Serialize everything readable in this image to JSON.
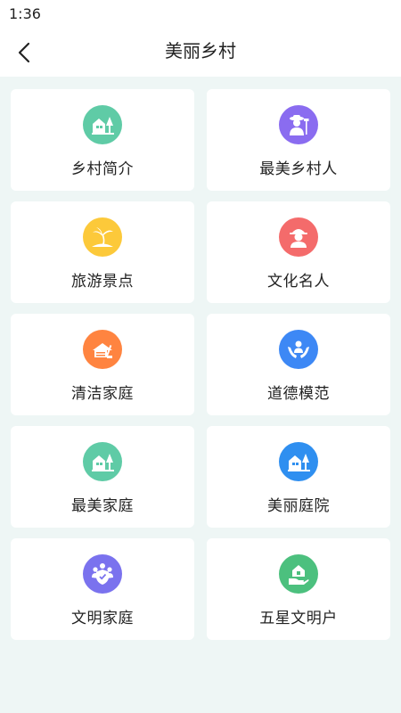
{
  "status": {
    "time": "1:36"
  },
  "header": {
    "title": "美丽乡村"
  },
  "colors": {
    "background": "#eef6f5",
    "green": "#5fcba6",
    "purple": "#8a6cf0",
    "yellow": "#fcc93a",
    "red": "#f46b6b",
    "orange": "#ff8440",
    "blue": "#3d88f5",
    "sky_blue": "#2f8ff0",
    "violet": "#7a72ee",
    "emerald": "#4cc07e"
  },
  "menu": [
    {
      "label": "乡村简介",
      "icon": "house-tree-icon",
      "color": "#5fcba6"
    },
    {
      "label": "最美乡村人",
      "icon": "farmer-icon",
      "color": "#8a6cf0"
    },
    {
      "label": "旅游景点",
      "icon": "palm-island-icon",
      "color": "#fcc93a"
    },
    {
      "label": "文化名人",
      "icon": "person-hat-icon",
      "color": "#f46b6b"
    },
    {
      "label": "清洁家庭",
      "icon": "clean-house-icon",
      "color": "#ff8440"
    },
    {
      "label": "道德模范",
      "icon": "hands-person-icon",
      "color": "#3d88f5"
    },
    {
      "label": "最美家庭",
      "icon": "house-tree-icon",
      "color": "#5fcba6"
    },
    {
      "label": "美丽庭院",
      "icon": "house-tree-icon",
      "color": "#2f8ff0"
    },
    {
      "label": "文明家庭",
      "icon": "family-shield-icon",
      "color": "#7a72ee"
    },
    {
      "label": "五星文明户",
      "icon": "hand-house-icon",
      "color": "#4cc07e"
    }
  ]
}
